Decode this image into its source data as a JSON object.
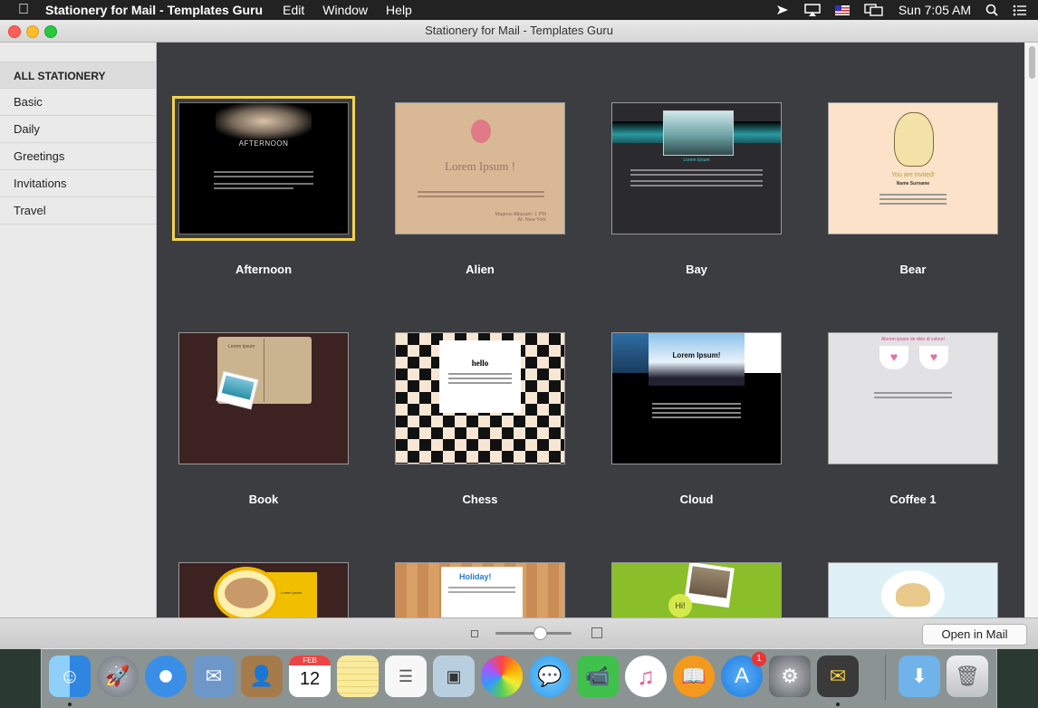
{
  "menubar": {
    "app_name": "Stationery for Mail - Templates Guru",
    "menus": [
      "Edit",
      "Window",
      "Help"
    ],
    "clock": "Sun 7:05 AM"
  },
  "window": {
    "title": "Stationery for Mail - Templates Guru",
    "open_button": "Open in Mail"
  },
  "sidebar": {
    "items": [
      "ALL STATIONERY",
      "Basic",
      "Daily",
      "Greetings",
      "Invitations",
      "Travel"
    ]
  },
  "templates": [
    {
      "name": "Afternoon",
      "selected": true,
      "preview_title": "AFTERNOON"
    },
    {
      "name": "Alien",
      "preview_title": "Lorem Ipsum !",
      "preview_line": "Magnus Aliquam: 1 PM",
      "preview_line2": "At: New York"
    },
    {
      "name": "Bay",
      "preview_title": "Lorem Ipsum"
    },
    {
      "name": "Bear",
      "preview_title": "You are invited!",
      "preview_line": "Name Surname"
    },
    {
      "name": "Book",
      "preview_title": "Lorem Ipsum"
    },
    {
      "name": "Chess",
      "preview_title": "hello"
    },
    {
      "name": "Cloud",
      "preview_title": "Lorem Ipsum!"
    },
    {
      "name": "Coffee 1",
      "preview_title": "Alorem ipsum de dolo di colore!"
    },
    {
      "name": "",
      "preview_title": "Lorem Ipsum"
    },
    {
      "name": "",
      "preview_title": "Holiday!"
    },
    {
      "name": "",
      "preview_title": "Hi!"
    },
    {
      "name": "",
      "preview_title": ""
    }
  ],
  "dock": {
    "apps": [
      {
        "icon": "finder-icon",
        "color": "#4aa0e8",
        "running": true
      },
      {
        "icon": "launchpad-icon",
        "color": "#8a8d94"
      },
      {
        "icon": "safari-icon",
        "color": "#3a8ee6"
      },
      {
        "icon": "mail-icon",
        "color": "#6d97c9"
      },
      {
        "icon": "contacts-icon",
        "color": "#a57b4c"
      },
      {
        "icon": "calendar-icon",
        "color": "#ffffff",
        "label": "12",
        "sublabel": "FEB"
      },
      {
        "icon": "notes-icon",
        "color": "#f5e27a"
      },
      {
        "icon": "reminders-icon",
        "color": "#f7f7f7"
      },
      {
        "icon": "preview-icon",
        "color": "#b9cfe0"
      },
      {
        "icon": "photos-icon",
        "color": "#f2f2f2"
      },
      {
        "icon": "messages-icon",
        "color": "#4ab0f5"
      },
      {
        "icon": "facetime-icon",
        "color": "#3fc14c"
      },
      {
        "icon": "itunes-icon",
        "color": "#f25d8a"
      },
      {
        "icon": "ibooks-icon",
        "color": "#f39a1e"
      },
      {
        "icon": "appstore-icon",
        "color": "#2d8ef0",
        "badge": "1"
      },
      {
        "icon": "system-preferences-icon",
        "color": "#8b8e93"
      },
      {
        "icon": "stationery-app-icon",
        "color": "#3a3a3a",
        "running": true
      },
      {
        "icon": "downloads-folder-icon",
        "color": "#6fb3ea"
      },
      {
        "icon": "trash-icon",
        "color": "#d8dadc"
      }
    ]
  }
}
